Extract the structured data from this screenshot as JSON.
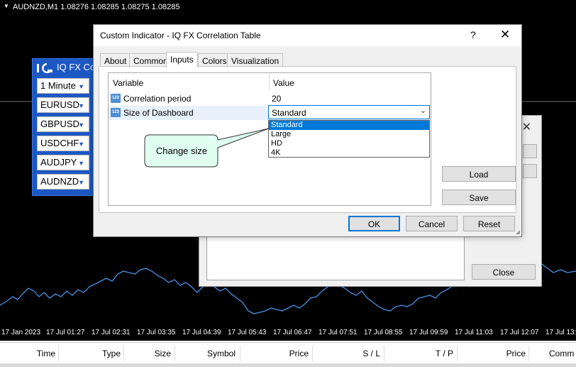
{
  "chart": {
    "symbol_line": "AUDNZD,M1  1.08276 1.08285 1.08275 1.08285",
    "time_labels": [
      "17 Jan 2023",
      "17 Jul 01:27",
      "17 Jul 02:31",
      "17 Jul 03:35",
      "17 Jul 04:39",
      "17 Jul 05:43",
      "17 Jul 06:47",
      "17 Jul 07:51",
      "17 Jul 08:55",
      "17 Jul 09:59",
      "17 Jul 11:03",
      "17 Jul 12:07",
      "17 Jul 13:"
    ]
  },
  "trade_table": {
    "headers": [
      "Time",
      "Type",
      "Size",
      "Symbol",
      "Price",
      "S / L",
      "T / P",
      "Price",
      "Comm"
    ]
  },
  "dashboard": {
    "title": "IQ FX Corr",
    "timeframe": "1 Minute",
    "pairs": [
      "EURUSD",
      "GBPUSD",
      "USDCHF",
      "AUDJPY",
      "AUDNZD"
    ]
  },
  "background_dialog": {
    "close_label": "Close"
  },
  "dialog": {
    "title": "Custom Indicator - IQ FX Correlation Table",
    "help": "?",
    "tabs": [
      "About",
      "Common",
      "Inputs",
      "Colors",
      "Visualization"
    ],
    "active_tab": "Inputs",
    "grid": {
      "col_variable": "Variable",
      "col_value": "Value",
      "rows": [
        {
          "variable": "Correlation period",
          "value": "20",
          "icon": "123"
        },
        {
          "variable": "Size of Dashboard",
          "value": "Standard",
          "icon": "123"
        }
      ]
    },
    "dropdown_options": [
      "Standard",
      "Large",
      "HD",
      "4K"
    ],
    "dropdown_selected": "Standard",
    "load_label": "Load",
    "save_label": "Save",
    "ok_label": "OK",
    "cancel_label": "Cancel",
    "reset_label": "Reset"
  },
  "callout": {
    "text": "Change size"
  },
  "colors": {
    "chart_bg": "#000000",
    "price_line": "#4a90e2",
    "accent": "#0078d7",
    "dashboard_bg": "#1c58c4",
    "callout_fill": "#e0fff0"
  }
}
